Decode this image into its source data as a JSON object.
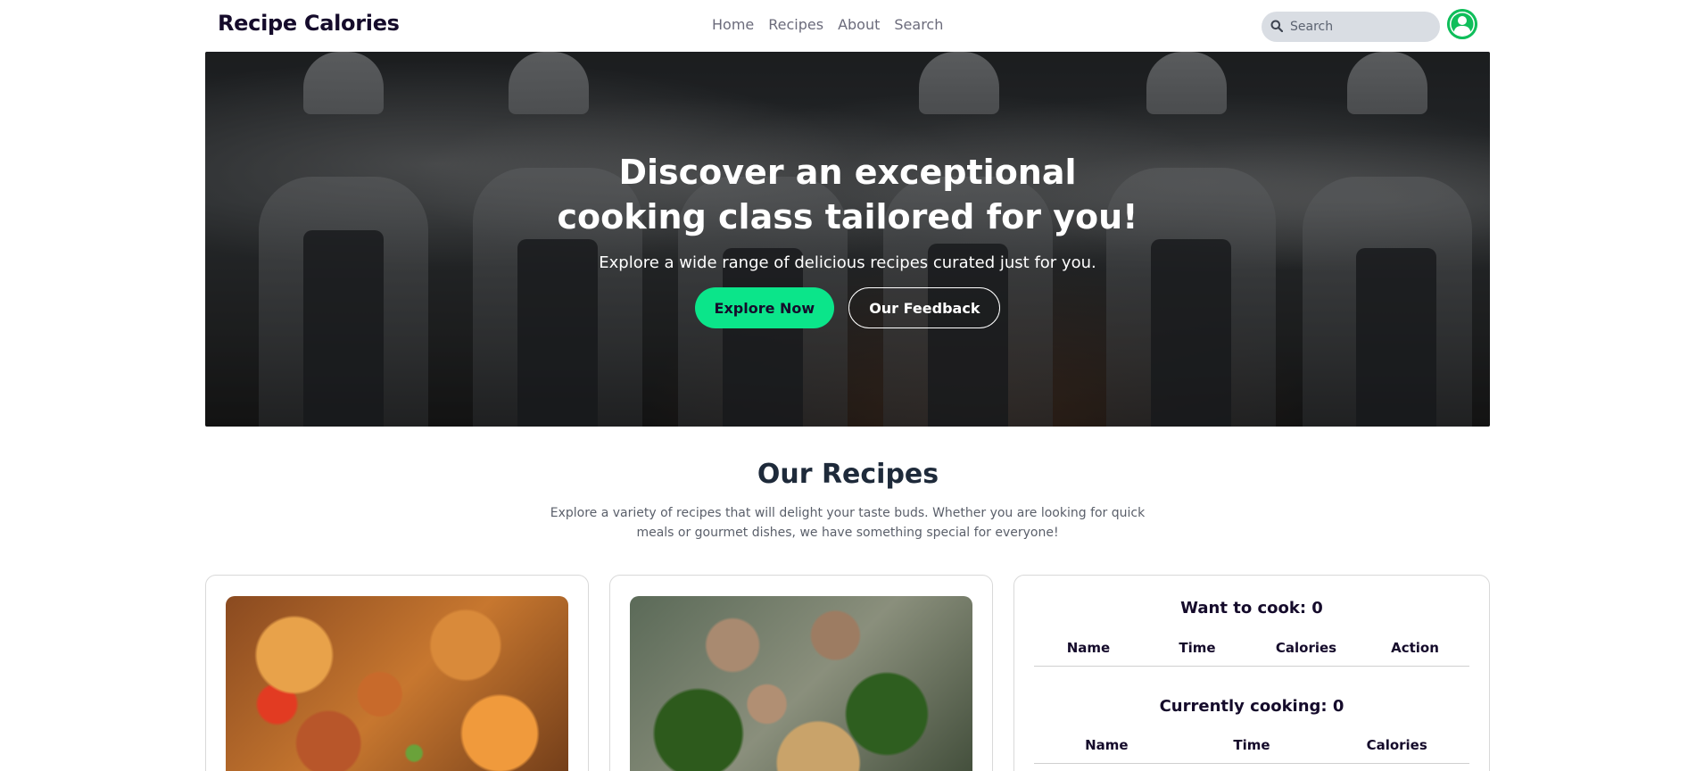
{
  "navbar": {
    "brand": "Recipe Calories",
    "links": [
      "Home",
      "Recipes",
      "About",
      "Search"
    ],
    "search_placeholder": "Search"
  },
  "hero": {
    "title": "Discover an exceptional cooking class tailored for you!",
    "subtitle": "Explore a wide range of delicious recipes curated just for you.",
    "primary_button": "Explore Now",
    "secondary_button": "Our Feedback"
  },
  "recipes": {
    "title": "Our Recipes",
    "description": "Explore a variety of recipes that will delight your taste buds. Whether you are looking for quick meals or gourmet dishes, we have something special for everyone!"
  },
  "want_to_cook": {
    "heading": "Want to cook: 0",
    "columns": [
      "Name",
      "Time",
      "Calories",
      "Action"
    ]
  },
  "currently_cooking": {
    "heading": "Currently cooking: 0",
    "columns": [
      "Name",
      "Time",
      "Calories"
    ]
  },
  "colors": {
    "accent": "#0be58a",
    "avatar": "#0fbe5a",
    "text_dark": "#150b2b"
  }
}
